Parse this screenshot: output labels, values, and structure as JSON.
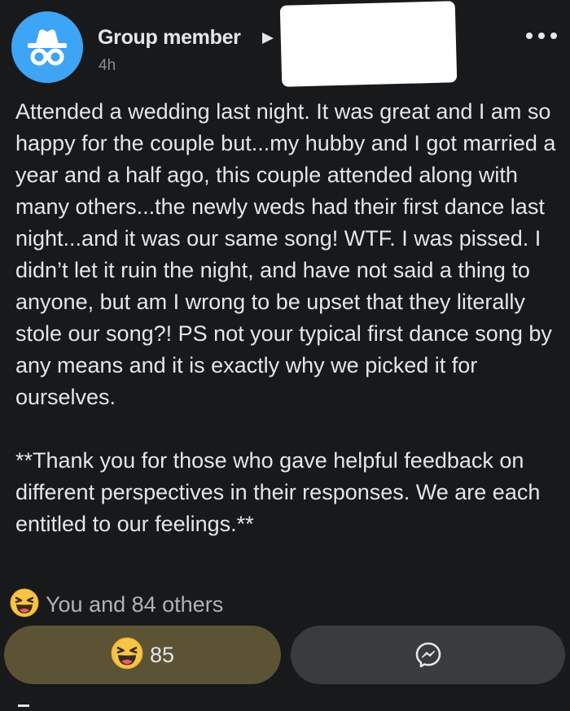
{
  "post": {
    "author": "Group member",
    "timestamp": "4h",
    "body_paragraphs": [
      "Attended a wedding last night. It was great and I am so happy for the couple but...my hubby and I got married a year and a half ago, this couple attended along with many others...the newly weds had their first dance last night...and it was our same song! WTF. I was pissed. I didn’t let it ruin the night, and have not said a thing to anyone, but am I wrong to be upset that they literally stole our song?! PS not your typical first dance song by any means and it is exactly why we picked it for ourselves.",
      "**Thank you for those who gave helpful feedback on different perspectives in their responses. We are each entitled to our feelings.**"
    ]
  },
  "reactions": {
    "summary_text": "You and 84 others",
    "count": "85",
    "icon": "haha-emoji-icon"
  },
  "icons": {
    "avatar": "anonymous-incognito-icon",
    "arrow": "right-arrow-icon",
    "more": "more-options-icon",
    "message": "messenger-icon"
  },
  "colors": {
    "background": "#18191a",
    "avatar_bg": "#3ea4f5",
    "react_button_bg": "#5c5234",
    "message_button_bg": "#3a3b3c",
    "text_primary": "#e4e6eb",
    "text_secondary": "#b0b3b8"
  }
}
